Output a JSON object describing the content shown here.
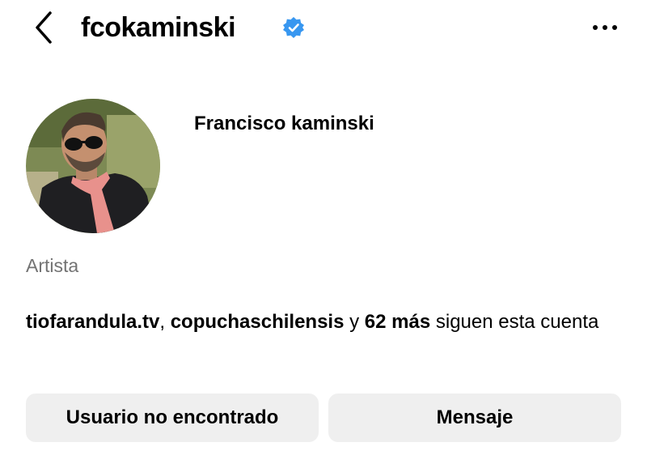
{
  "header": {
    "username": "fcokaminski",
    "verified": true,
    "back_icon": "chevron-left-icon",
    "more_icon": "ellipsis-icon"
  },
  "profile": {
    "full_name": "Francisco kaminski",
    "category": "Artista"
  },
  "followed_by": {
    "account_1": "tiofarandula.tv",
    "separator": ", ",
    "account_2": "copuchaschilensis",
    "connector": " y ",
    "others": "62 más",
    "suffix": " siguen esta cuenta"
  },
  "actions": {
    "primary_label": "Usuario no encontrado",
    "secondary_label": "Mensaje"
  },
  "colors": {
    "verified_blue": "#3897f0",
    "button_bg": "#efefef",
    "muted_text": "#737373"
  }
}
